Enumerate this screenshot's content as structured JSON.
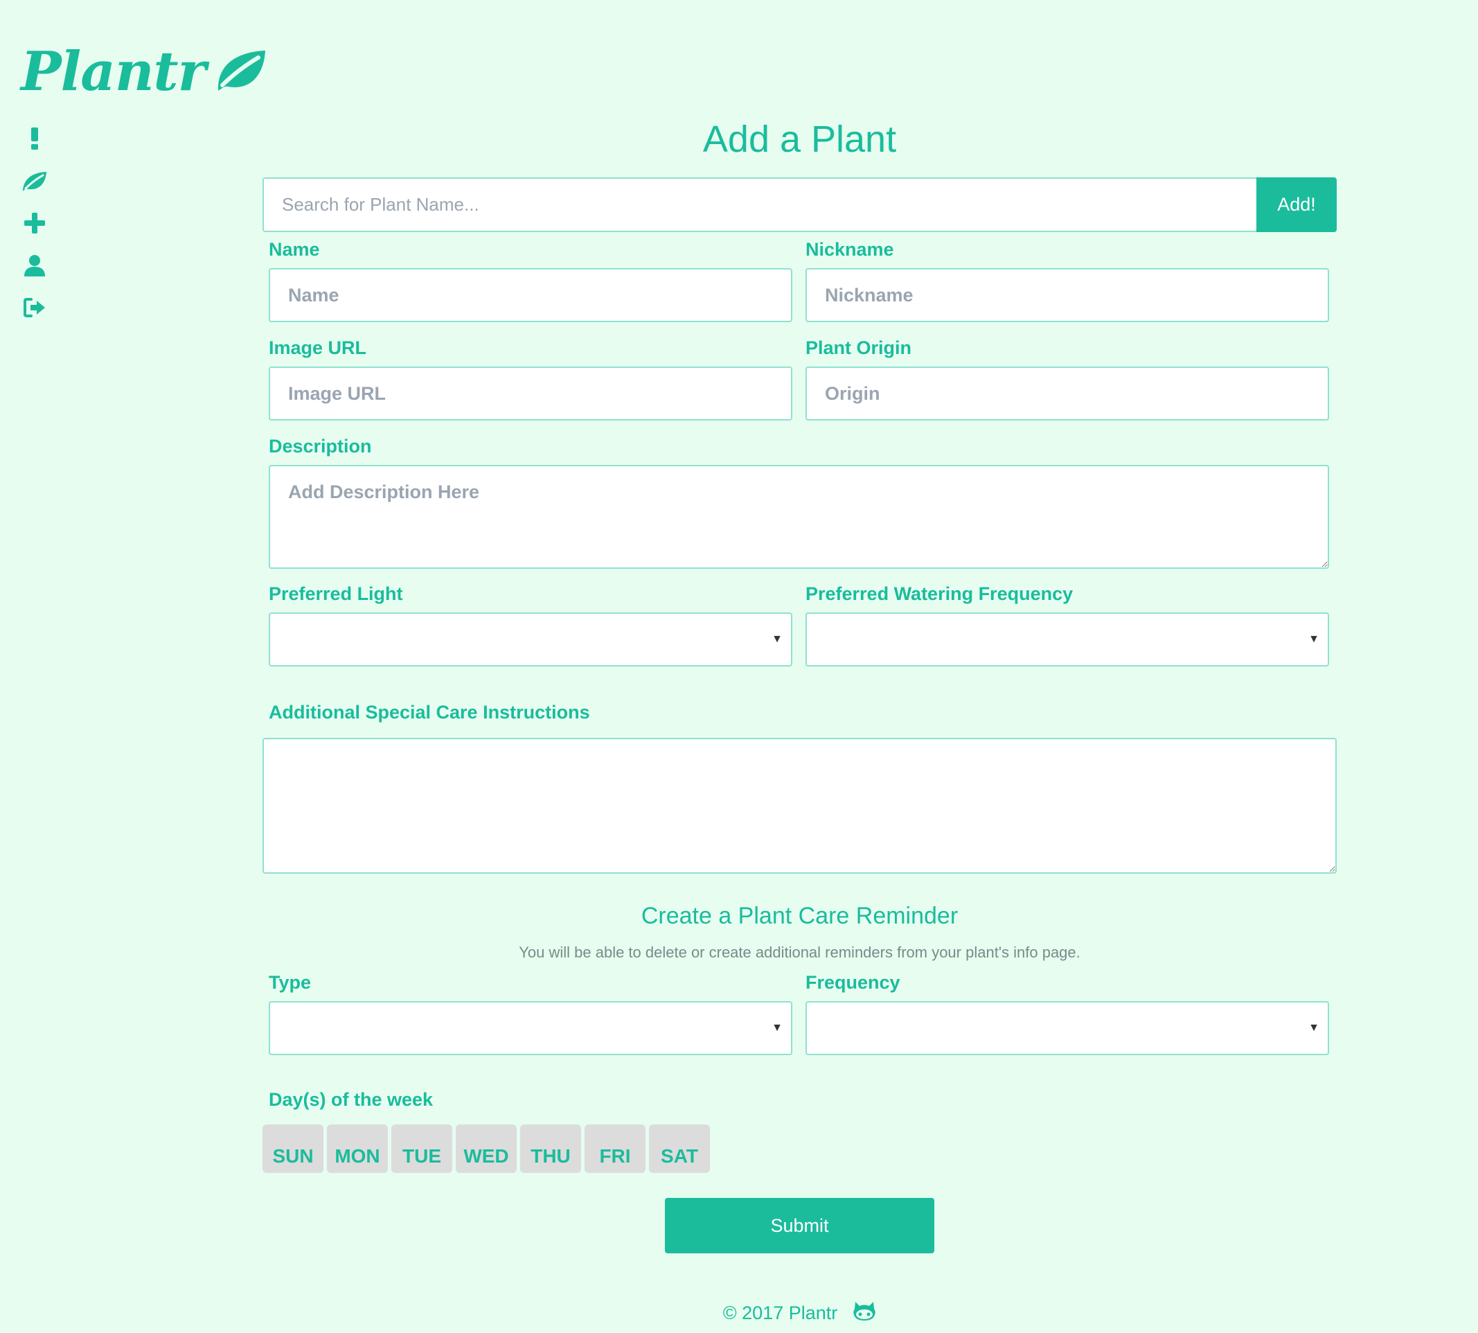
{
  "brand": {
    "name": "Plantr"
  },
  "sidebar": {
    "items": [
      {
        "name": "alerts",
        "icon": "exclamation-icon"
      },
      {
        "name": "plants",
        "icon": "leaf-icon"
      },
      {
        "name": "add-plant",
        "icon": "plus-icon"
      },
      {
        "name": "profile",
        "icon": "user-icon"
      },
      {
        "name": "logout",
        "icon": "sign-out-icon"
      }
    ]
  },
  "page": {
    "title": "Add a Plant"
  },
  "search": {
    "placeholder": "Search for Plant Name...",
    "value": "",
    "button": "Add!"
  },
  "form": {
    "name": {
      "label": "Name",
      "placeholder": "Name",
      "value": ""
    },
    "nickname": {
      "label": "Nickname",
      "placeholder": "Nickname",
      "value": ""
    },
    "image_url": {
      "label": "Image URL",
      "placeholder": "Image URL",
      "value": ""
    },
    "origin": {
      "label": "Plant Origin",
      "placeholder": "Origin",
      "value": ""
    },
    "description": {
      "label": "Description",
      "placeholder": "Add Description Here",
      "value": ""
    },
    "light": {
      "label": "Preferred Light",
      "value": ""
    },
    "watering": {
      "label": "Preferred Watering Frequency",
      "value": ""
    },
    "care": {
      "label": "Additional Special Care Instructions",
      "value": ""
    }
  },
  "reminder": {
    "title": "Create a Plant Care Reminder",
    "note": "You will be able to delete or create additional reminders from your plant's info page.",
    "type": {
      "label": "Type",
      "value": ""
    },
    "frequency": {
      "label": "Frequency",
      "value": ""
    },
    "days_label": "Day(s) of the week",
    "days": [
      "SUN",
      "MON",
      "TUE",
      "WED",
      "THU",
      "FRI",
      "SAT"
    ]
  },
  "submit": "Submit",
  "footer": {
    "copyright": "© 2017 Plantr",
    "icon": "github-icon"
  },
  "colors": {
    "accent": "#1abc9c",
    "background": "#e6fdf0",
    "border": "#8fe1cf",
    "day_bg": "#dcdcdc"
  }
}
